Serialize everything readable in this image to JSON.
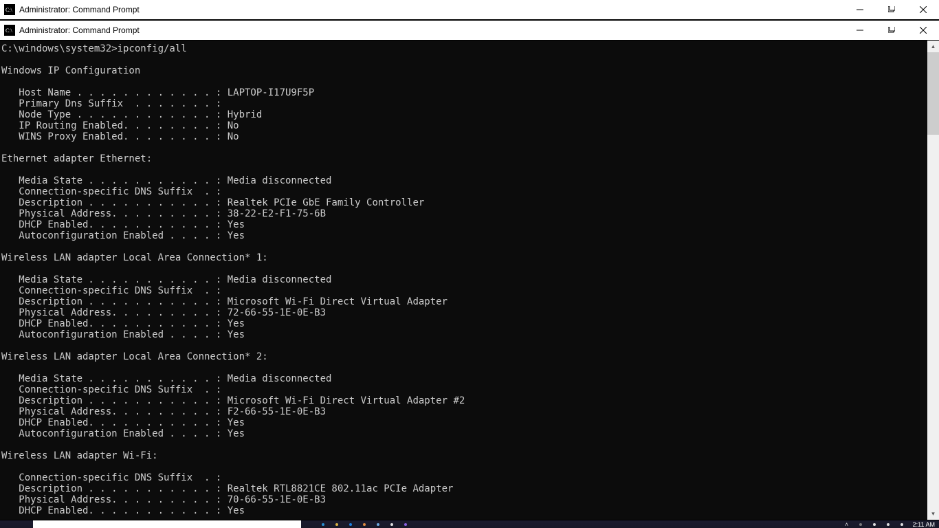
{
  "outer_window": {
    "title": "Administrator: Command Prompt"
  },
  "inner_window": {
    "title": "Administrator: Command Prompt"
  },
  "terminal": {
    "prompt": "C:\\windows\\system32>",
    "command": "ipconfig/all",
    "header": "Windows IP Configuration",
    "global": [
      {
        "label": "Host Name . . . . . . . . . . . . :",
        "value": " LAPTOP-I17U9F5P"
      },
      {
        "label": "Primary Dns Suffix  . . . . . . . :",
        "value": ""
      },
      {
        "label": "Node Type . . . . . . . . . . . . :",
        "value": " Hybrid"
      },
      {
        "label": "IP Routing Enabled. . . . . . . . :",
        "value": " No"
      },
      {
        "label": "WINS Proxy Enabled. . . . . . . . :",
        "value": " No"
      }
    ],
    "adapters": [
      {
        "title": "Ethernet adapter Ethernet:",
        "rows": [
          {
            "label": "Media State . . . . . . . . . . . :",
            "value": " Media disconnected"
          },
          {
            "label": "Connection-specific DNS Suffix  . :",
            "value": ""
          },
          {
            "label": "Description . . . . . . . . . . . :",
            "value": " Realtek PCIe GbE Family Controller"
          },
          {
            "label": "Physical Address. . . . . . . . . :",
            "value": " 38-22-E2-F1-75-6B"
          },
          {
            "label": "DHCP Enabled. . . . . . . . . . . :",
            "value": " Yes"
          },
          {
            "label": "Autoconfiguration Enabled . . . . :",
            "value": " Yes"
          }
        ]
      },
      {
        "title": "Wireless LAN adapter Local Area Connection* 1:",
        "rows": [
          {
            "label": "Media State . . . . . . . . . . . :",
            "value": " Media disconnected"
          },
          {
            "label": "Connection-specific DNS Suffix  . :",
            "value": ""
          },
          {
            "label": "Description . . . . . . . . . . . :",
            "value": " Microsoft Wi-Fi Direct Virtual Adapter"
          },
          {
            "label": "Physical Address. . . . . . . . . :",
            "value": " 72-66-55-1E-0E-B3"
          },
          {
            "label": "DHCP Enabled. . . . . . . . . . . :",
            "value": " Yes"
          },
          {
            "label": "Autoconfiguration Enabled . . . . :",
            "value": " Yes"
          }
        ]
      },
      {
        "title": "Wireless LAN adapter Local Area Connection* 2:",
        "rows": [
          {
            "label": "Media State . . . . . . . . . . . :",
            "value": " Media disconnected"
          },
          {
            "label": "Connection-specific DNS Suffix  . :",
            "value": ""
          },
          {
            "label": "Description . . . . . . . . . . . :",
            "value": " Microsoft Wi-Fi Direct Virtual Adapter #2"
          },
          {
            "label": "Physical Address. . . . . . . . . :",
            "value": " F2-66-55-1E-0E-B3"
          },
          {
            "label": "DHCP Enabled. . . . . . . . . . . :",
            "value": " Yes"
          },
          {
            "label": "Autoconfiguration Enabled . . . . :",
            "value": " Yes"
          }
        ]
      },
      {
        "title": "Wireless LAN adapter Wi-Fi:",
        "rows": [
          {
            "label": "Connection-specific DNS Suffix  . :",
            "value": ""
          },
          {
            "label": "Description . . . . . . . . . . . :",
            "value": " Realtek RTL8821CE 802.11ac PCIe Adapter"
          },
          {
            "label": "Physical Address. . . . . . . . . :",
            "value": " 70-66-55-1E-0E-B3"
          },
          {
            "label": "DHCP Enabled. . . . . . . . . . . :",
            "value": " Yes"
          }
        ]
      }
    ]
  },
  "taskbar": {
    "clock": "2:11 AM"
  }
}
